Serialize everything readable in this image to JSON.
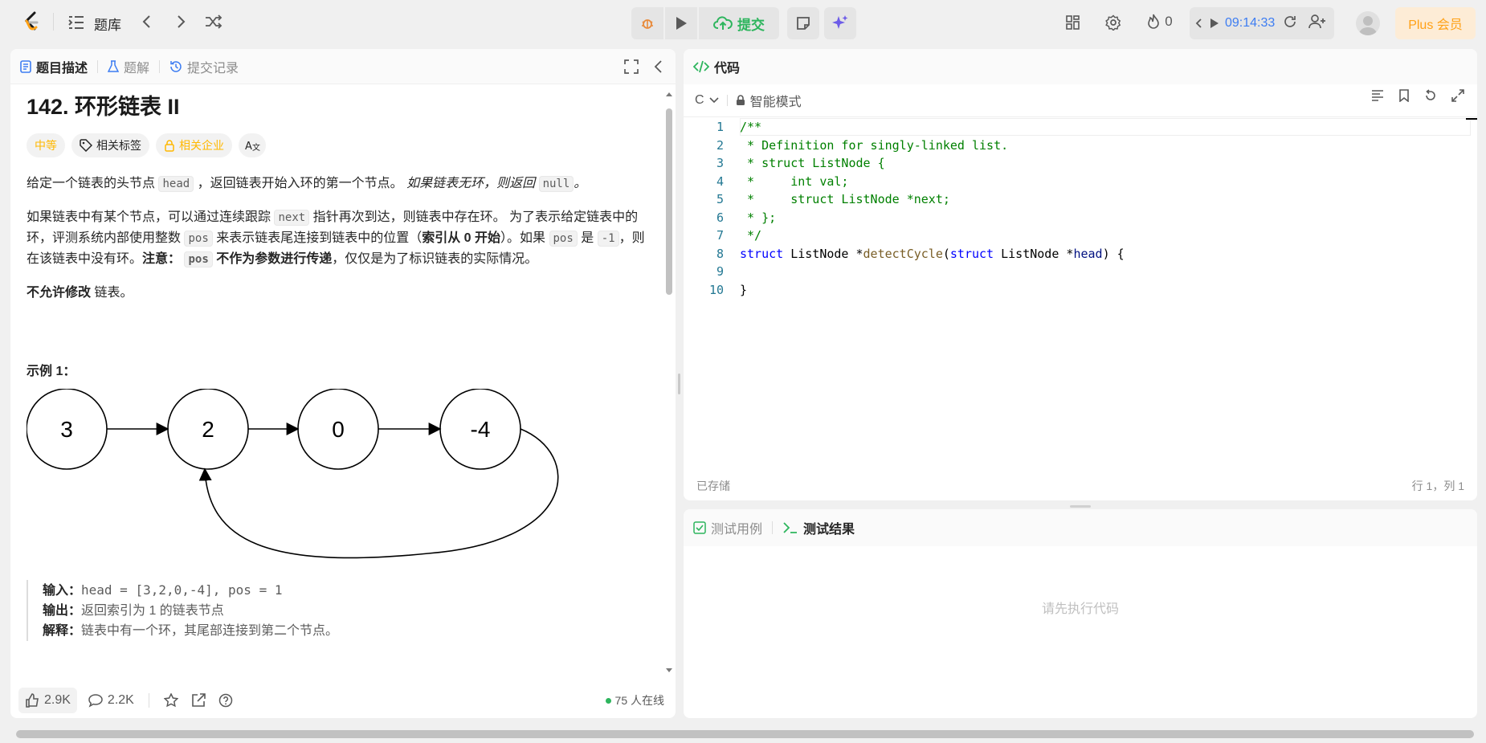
{
  "header": {
    "problem_list_label": "题库",
    "submit_label": "提交",
    "streak_count": "0",
    "timer": "09:14:33",
    "plus_label": "Plus 会员"
  },
  "left_panel": {
    "tabs": [
      {
        "label": "题目描述"
      },
      {
        "label": "题解"
      },
      {
        "label": "提交记录"
      }
    ],
    "title": "142. 环形链表 II",
    "tags": {
      "difficulty": "中等",
      "related_tags": "相关标签",
      "related_companies": "相关企业",
      "translate": "A文"
    },
    "p1_a": "给定一个链表的头节点",
    "p1_code": "head",
    "p1_b": "，返回链表开始入环的第一个节点。",
    "p1_c": "如果链表无环，则返回",
    "p1_code2": "null",
    "p1_d": "。",
    "p2_a": "如果链表中有某个节点，可以通过连续跟踪",
    "p2_code1": "next",
    "p2_b": "指针再次到达，则链表中存在环。 为了表示给定链表中的环，评测系统内部使用整数",
    "p2_code2": "pos",
    "p2_c": "来表示链表尾连接到链表中的位置（",
    "p2_bold1": "索引从 0 开始",
    "p2_d": "）。如果",
    "p2_code3": "pos",
    "p2_e": "是",
    "p2_code4": "-1",
    "p2_f": "，则在该链表中没有环。",
    "p2_bold2": "注意：",
    "p2_code5": "pos",
    "p2_bold3": "不作为参数进行传递",
    "p2_g": "，仅仅是为了标识链表的实际情况。",
    "p3_bold": "不允许修改",
    "p3_text": "链表。",
    "example_title": "示例 1：",
    "diagram_nodes": [
      "3",
      "2",
      "0",
      "-4"
    ],
    "example": {
      "input_label": "输入：",
      "input_value": "head = [3,2,0,-4], pos = 1",
      "output_label": "输出：",
      "output_value": "返回索引为 1 的链表节点",
      "explain_label": "解释：",
      "explain_value": "链表中有一个环，其尾部连接到第二个节点。"
    },
    "footer": {
      "likes": "2.9K",
      "comments": "2.2K",
      "online": "75 人在线"
    }
  },
  "code_panel": {
    "title": "代码",
    "language": "C",
    "mode": "智能模式",
    "line_numbers": [
      "1",
      "2",
      "3",
      "4",
      "5",
      "6",
      "7",
      "8",
      "9",
      "10"
    ],
    "saved": "已存储",
    "cursor": "行 1，列 1"
  },
  "result_panel": {
    "tab_testcase": "测试用例",
    "tab_result": "测试结果",
    "empty": "请先执行代码"
  }
}
